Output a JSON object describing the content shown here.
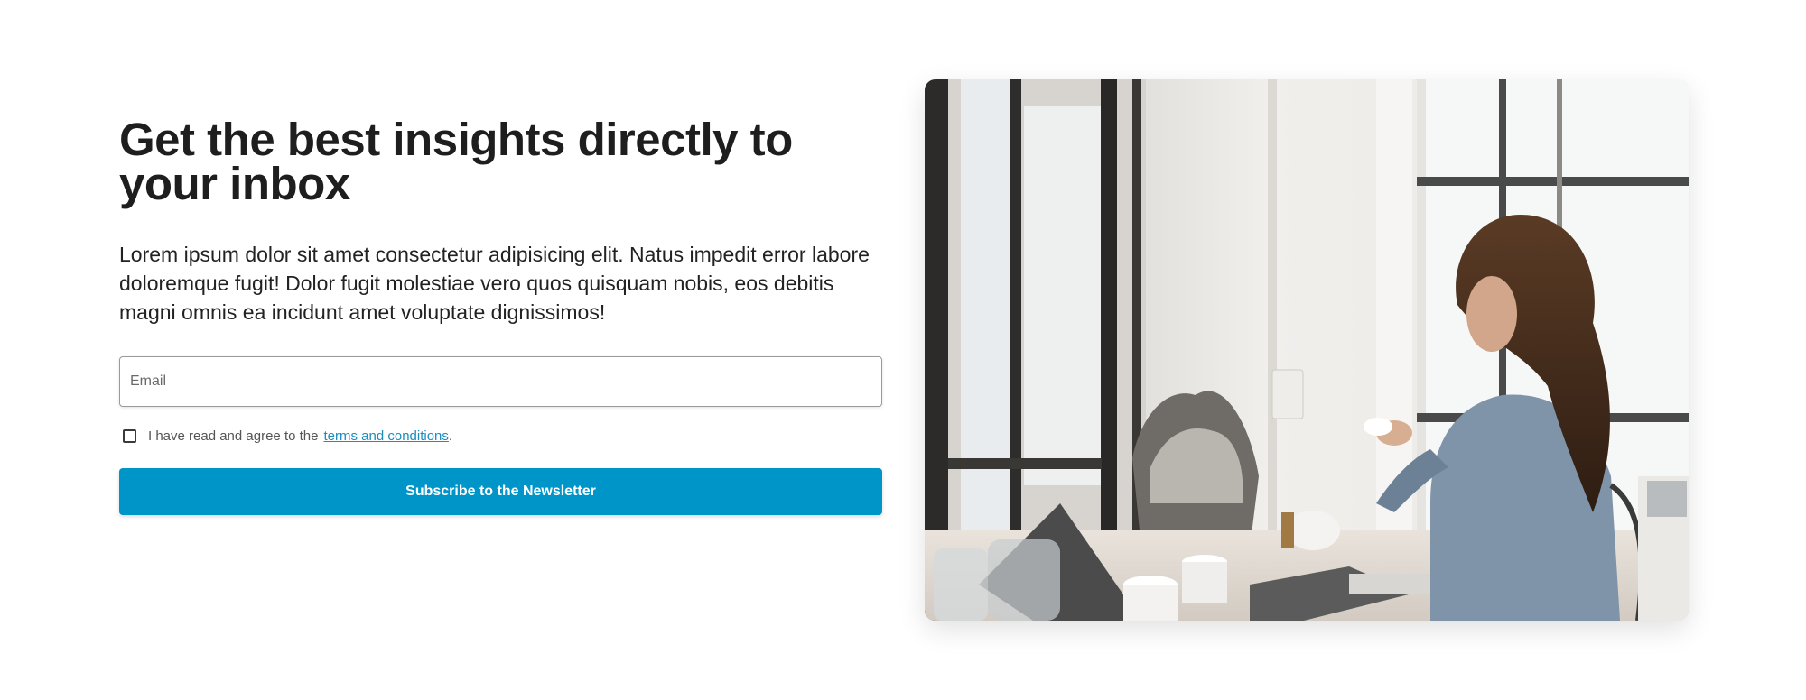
{
  "hero": {
    "headline": "Get the best insights directly to your inbox",
    "body": "Lorem ipsum dolor sit amet consectetur adipisicing elit. Natus impedit error labore doloremque fugit! Dolor fugit molestiae vero quos quisquam nobis, eos debitis magni omnis ea incidunt amet voluptate dignissimos!"
  },
  "form": {
    "email_placeholder": "Email",
    "email_value": "",
    "consent_prefix": "I have read and agree to the",
    "terms_link_label": "terms and conditions",
    "consent_suffix": ".",
    "consent_checked": false,
    "submit_label": "Subscribe to the Newsletter"
  },
  "photo": {
    "subject": "woman-at-window-with-laptop-and-coffee-cup"
  },
  "colors": {
    "accent": "#0095c8",
    "link": "#1a8cc0",
    "heading": "#1e1e1e",
    "text": "#222222"
  }
}
